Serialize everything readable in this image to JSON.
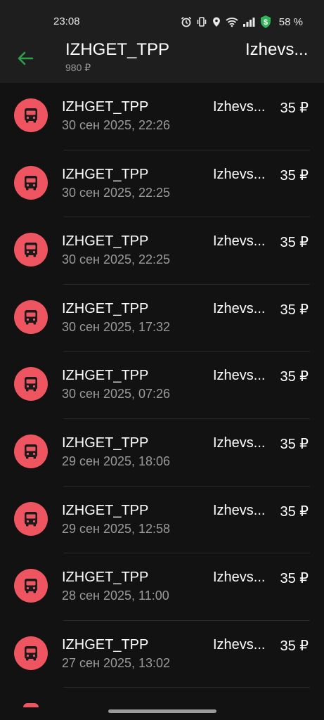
{
  "status_bar": {
    "time": "23:08",
    "battery": "58 %"
  },
  "header": {
    "title": "IZHGET_TPP",
    "amount": "980 ₽",
    "city": "Izhevs..."
  },
  "transactions": [
    {
      "merchant": "IZHGET_TPP",
      "date": "30 сен 2025, 22:26",
      "city": "Izhevs...",
      "amount": "35 ₽",
      "icon": "bus-icon"
    },
    {
      "merchant": "IZHGET_TPP",
      "date": "30 сен 2025, 22:25",
      "city": "Izhevs...",
      "amount": "35 ₽",
      "icon": "bus-icon"
    },
    {
      "merchant": "IZHGET_TPP",
      "date": "30 сен 2025, 22:25",
      "city": "Izhevs...",
      "amount": "35 ₽",
      "icon": "bus-icon"
    },
    {
      "merchant": "IZHGET_TPP",
      "date": "30 сен 2025, 17:32",
      "city": "Izhevs...",
      "amount": "35 ₽",
      "icon": "bus-icon"
    },
    {
      "merchant": "IZHGET_TPP",
      "date": "30 сен 2025, 07:26",
      "city": "Izhevs...",
      "amount": "35 ₽",
      "icon": "bus-icon"
    },
    {
      "merchant": "IZHGET_TPP",
      "date": "29 сен 2025, 18:06",
      "city": "Izhevs...",
      "amount": "35 ₽",
      "icon": "bus-icon"
    },
    {
      "merchant": "IZHGET_TPP",
      "date": "29 сен 2025, 12:58",
      "city": "Izhevs...",
      "amount": "35 ₽",
      "icon": "bus-icon"
    },
    {
      "merchant": "IZHGET_TPP",
      "date": "28 сен 2025, 11:00",
      "city": "Izhevs...",
      "amount": "35 ₽",
      "icon": "bus-icon"
    },
    {
      "merchant": "IZHGET_TPP",
      "date": "27 сен 2025, 13:02",
      "city": "Izhevs...",
      "amount": "35 ₽",
      "icon": "bus-icon"
    }
  ],
  "colors": {
    "accent": "#2e9e4a",
    "icon_bg": "#ef5560",
    "background": "#121212",
    "header_bg": "#1e1e1e"
  }
}
